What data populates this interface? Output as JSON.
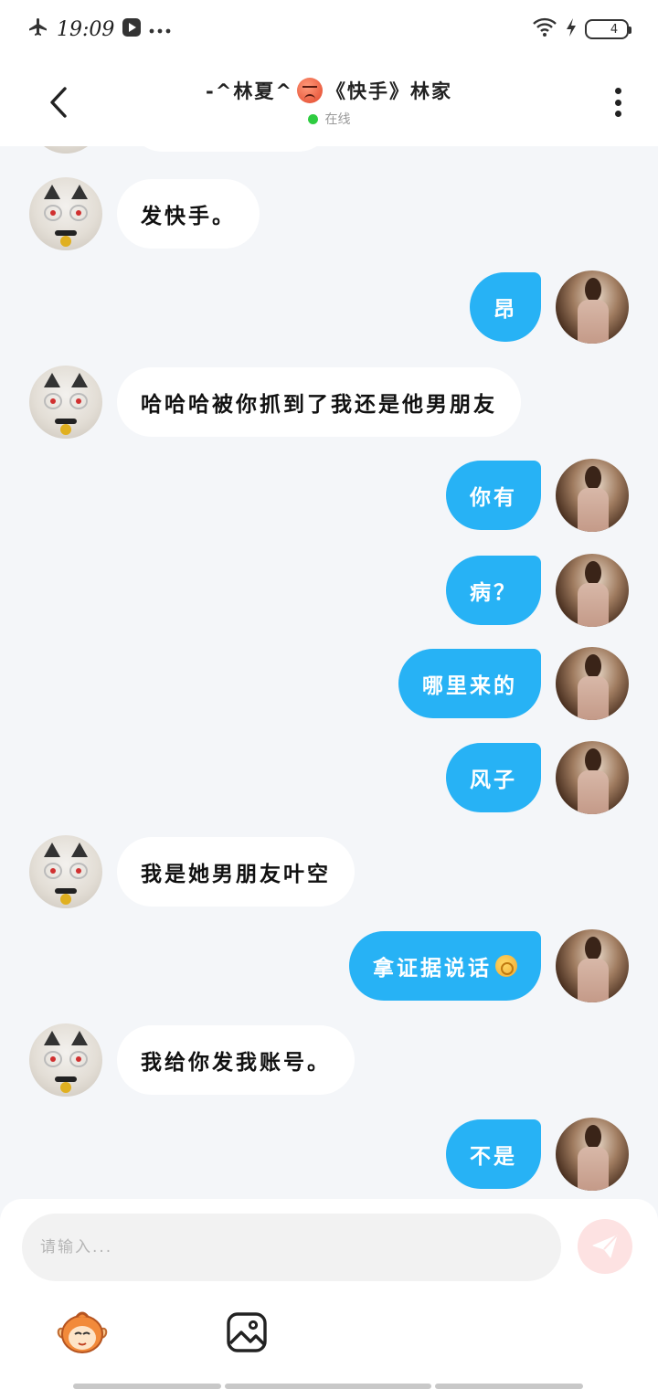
{
  "status_bar": {
    "time": "19:09",
    "battery_level": "4"
  },
  "header": {
    "title_prefix": "-^林夏^",
    "title_suffix": "《快手》林家",
    "status": "在线"
  },
  "messages": [
    {
      "side": "left",
      "text": "发快手。"
    },
    {
      "side": "right",
      "text": "昂"
    },
    {
      "side": "left",
      "text": "哈哈哈被你抓到了我还是他男朋友"
    },
    {
      "side": "right",
      "text": "你有"
    },
    {
      "side": "right",
      "text": "病？"
    },
    {
      "side": "right",
      "text": "哪里来的"
    },
    {
      "side": "right",
      "text": "风子"
    },
    {
      "side": "left",
      "text": "我是她男朋友叶空"
    },
    {
      "side": "right",
      "text": "拿证据说话"
    },
    {
      "side": "left",
      "text": "我给你发我账号。"
    },
    {
      "side": "right",
      "text": "不是"
    }
  ],
  "composer": {
    "placeholder": "请输入..."
  },
  "colors": {
    "outgoing_bubble": "#27b2f5",
    "incoming_bubble": "#ffffff",
    "online_dot": "#2ecc40",
    "send_button": "#fde2e2"
  },
  "icons": {
    "status_left": [
      "airplane-icon",
      "video-notification-icon",
      "more-notifications-icon"
    ],
    "status_right": [
      "wifi-icon",
      "charging-icon",
      "battery-icon"
    ],
    "header": [
      "back-arrow-icon",
      "more-vertical-icon",
      "angry-face-emoji"
    ],
    "composer": [
      "send-icon",
      "mascot-sticker-icon",
      "image-icon"
    ],
    "message_emoji": "ok-hand-emoji"
  }
}
